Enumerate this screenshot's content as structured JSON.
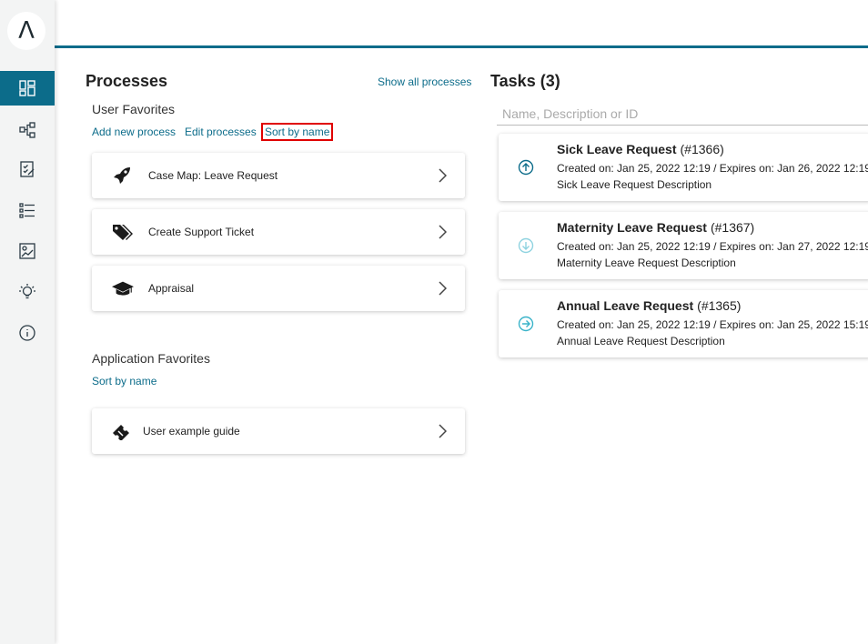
{
  "sidebar": {
    "logo": "Λ",
    "items": [
      {
        "icon": "dashboard-icon",
        "active": true
      },
      {
        "icon": "process-tree-icon",
        "active": false
      },
      {
        "icon": "checklist-edit-icon",
        "active": false
      },
      {
        "icon": "list-icon",
        "active": false
      },
      {
        "icon": "statistics-icon",
        "active": false
      },
      {
        "icon": "lightbulb-icon",
        "active": false
      },
      {
        "icon": "info-icon",
        "active": false
      }
    ]
  },
  "processes": {
    "title": "Processes",
    "show_all": "Show all processes",
    "user_favorites": {
      "title": "User Favorites",
      "add": "Add new process",
      "edit": "Edit processes",
      "sort": "Sort by name",
      "items": [
        {
          "label": "Case Map: Leave Request",
          "icon": "rocket-icon"
        },
        {
          "label": "Create Support Ticket",
          "icon": "tags-icon"
        },
        {
          "label": "Appraisal",
          "icon": "graduation-cap-icon"
        }
      ]
    },
    "app_favorites": {
      "title": "Application Favorites",
      "sort": "Sort by name",
      "items": [
        {
          "label": "User example guide",
          "icon": "ticket-icon"
        }
      ]
    }
  },
  "tasks": {
    "title": "Tasks (3)",
    "search_placeholder": "Name, Description or ID",
    "items": [
      {
        "name": "Sick Leave Request",
        "id": "(#1366)",
        "meta": "Created on: Jan 25, 2022 12:19 / Expires on: Jan 26, 2022 12:19",
        "desc": "Sick Leave Request Description",
        "priority_icon": "arrow-up-circle-icon",
        "color": "#0c6c8a"
      },
      {
        "name": "Maternity Leave Request",
        "id": "(#1367)",
        "meta": "Created on: Jan 25, 2022 12:19 / Expires on: Jan 27, 2022 12:19",
        "desc": "Maternity Leave Request Description",
        "priority_icon": "arrow-down-circle-icon",
        "color": "#8fd3e0"
      },
      {
        "name": "Annual Leave Request",
        "id": "(#1365)",
        "meta": "Created on: Jan 25, 2022 12:19 / Expires on: Jan 25, 2022 15:19",
        "desc": "Annual Leave Request Description",
        "priority_icon": "arrow-right-circle-icon",
        "color": "#39b3c9"
      }
    ]
  },
  "colors": {
    "accent": "#0c6c8a",
    "highlight": "#e00000"
  }
}
